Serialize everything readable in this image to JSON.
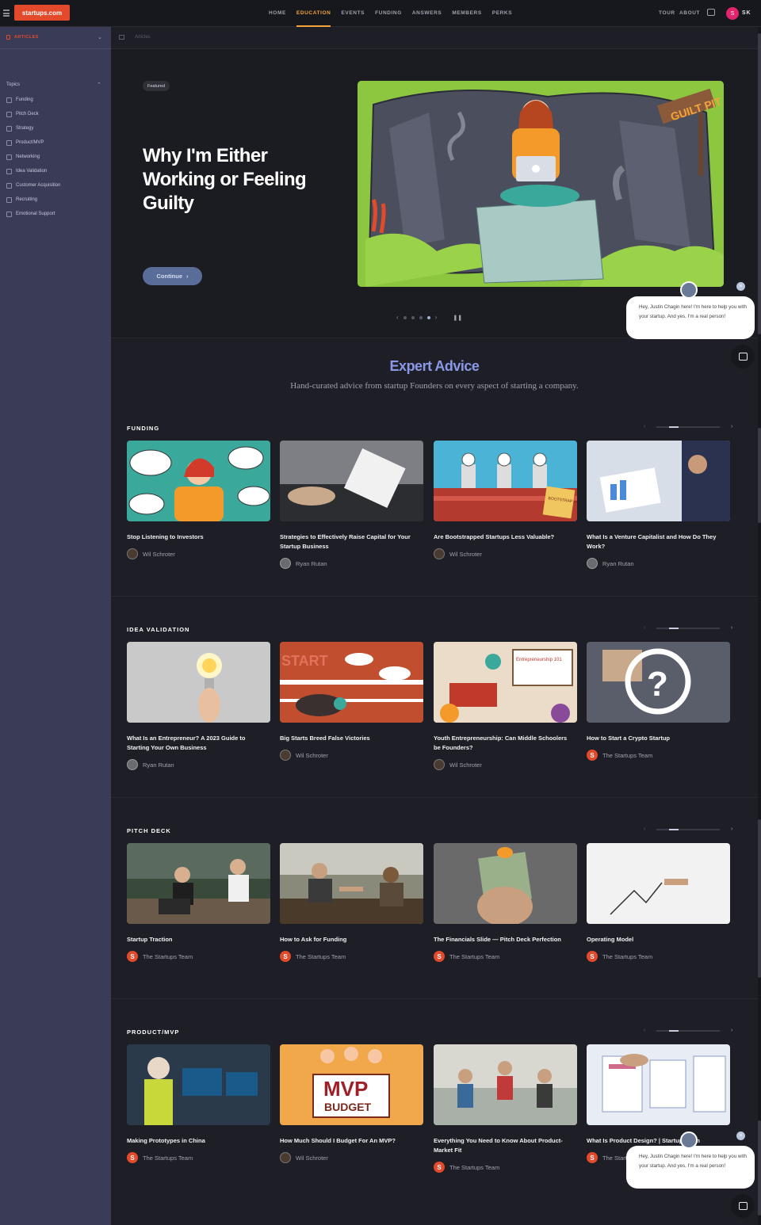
{
  "header": {
    "logo": "startups.com",
    "nav": [
      "HOME",
      "EDUCATION",
      "EVENTS",
      "FUNDING",
      "ANSWERS",
      "MEMBERS",
      "PERKS"
    ],
    "active_nav": "EDUCATION",
    "tour": "TOUR",
    "about": "ABOUT",
    "avatar_letter": "S",
    "initials": "SK"
  },
  "sidebar": {
    "section": "ARTICLES",
    "topics_label": "Topics",
    "topics": [
      "Funding",
      "Pitch Deck",
      "Strategy",
      "Product/MVP",
      "Networking",
      "Idea Validation",
      "Customer Acquisition",
      "Recruiting",
      "Emotional Support"
    ]
  },
  "breadcrumb": "Articles",
  "hero": {
    "badge": "Featured",
    "title": "Why I'm Either Working or Feeling Guilty",
    "button": "Continue",
    "sign_text": "GUILT PIT",
    "slide_count": 4,
    "active_slide": 4
  },
  "expert": {
    "title": "Expert Advice",
    "subtitle": "Hand-curated advice from startup Founders on every aspect of starting a company."
  },
  "sections": [
    {
      "title": "FUNDING",
      "cards": [
        {
          "title": "Stop Listening to Investors",
          "author": "Wil Schroter",
          "av": "w"
        },
        {
          "title": "Strategies to Effectively Raise Capital for Your Startup Business",
          "author": "Ryan Rutan",
          "av": "r"
        },
        {
          "title": "Are Bootstrapped Startups Less Valuable?",
          "author": "Wil Schroter",
          "av": "w"
        },
        {
          "title": "What Is a Venture Capitalist and How Do They Work?",
          "author": "Ryan Rutan",
          "av": "r"
        }
      ]
    },
    {
      "title": "IDEA VALIDATION",
      "cards": [
        {
          "title": "What Is an Entrepreneur? A 2023 Guide to Starting Your Own Business",
          "author": "Ryan Rutan",
          "av": "r"
        },
        {
          "title": "Big Starts Breed False Victories",
          "author": "Wil Schroter",
          "av": "w"
        },
        {
          "title": "Youth Entrepreneurship: Can Middle Schoolers be Founders?",
          "author": "Wil Schroter",
          "av": "w"
        },
        {
          "title": "How to Start a Crypto Startup",
          "author": "The Startups Team",
          "av": "s"
        }
      ]
    },
    {
      "title": "PITCH DECK",
      "cards": [
        {
          "title": "Startup Traction",
          "author": "The Startups Team",
          "av": "s"
        },
        {
          "title": "How to Ask for Funding",
          "author": "The Startups Team",
          "av": "s"
        },
        {
          "title": "The Financials Slide — Pitch Deck Perfection",
          "author": "The Startups Team",
          "av": "s"
        },
        {
          "title": "Operating Model",
          "author": "The Startups Team",
          "av": "s"
        }
      ]
    },
    {
      "title": "PRODUCT/MVP",
      "cards": [
        {
          "title": "Making Prototypes in China",
          "author": "The Startups Team",
          "av": "s"
        },
        {
          "title": "How Much Should I Budget For An MVP?",
          "author": "Wil Schroter",
          "av": "w"
        },
        {
          "title": "Everything You Need to Know About Product-Market Fit",
          "author": "The Startups Team",
          "av": "s"
        },
        {
          "title": "What Is Product Design? | Startups.com",
          "author": "The Startups Team",
          "av": "s"
        }
      ]
    }
  ],
  "thumb_text": {
    "mvp": "MVP",
    "budget": "BUDGET",
    "entre": "Entrepreneurship 101",
    "bootstrap": "BOOTSTRAP WALL OF FAME",
    "start": "START"
  },
  "chat": {
    "message": "Hey, Justin Chagin here! I'm here to help you with your startup. And yes, I'm a real person!",
    "close": "×"
  },
  "colors": {
    "brand": "#e24a2b",
    "accent": "#f4a53a",
    "expert": "#8b98e6"
  }
}
